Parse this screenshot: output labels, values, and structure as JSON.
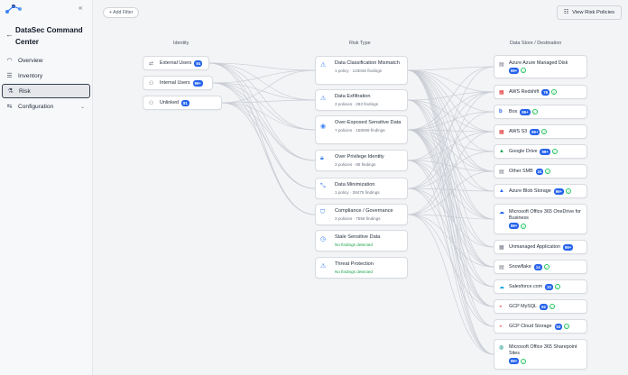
{
  "sidebar": {
    "app_title": "DataSec Command Center",
    "nav": [
      {
        "label": "Overview",
        "icon": "overview-icon"
      },
      {
        "label": "Inventory",
        "icon": "list-icon"
      },
      {
        "label": "Risk",
        "icon": "flask-icon",
        "active": true
      },
      {
        "label": "Configuration",
        "icon": "settings-icon"
      }
    ]
  },
  "toolbar": {
    "add_filter": "+ Add Filter",
    "view_risk_policies": "View Risk Policies"
  },
  "columns": {
    "identity": "Identity",
    "risk_type": "Risk Type",
    "data_store": "Data Store / Destination"
  },
  "identities": [
    {
      "label": "External Users",
      "count": "84"
    },
    {
      "label": "Internal Users",
      "count": "99+"
    },
    {
      "label": "Unlinked",
      "count": "81"
    }
  ],
  "risks": [
    {
      "title": "Data Classification Mismatch",
      "sub": "1 policy · 123046 findings"
    },
    {
      "title": "Data Exfiltration",
      "sub": "3 policies · 293 findings"
    },
    {
      "title": "Over-Exposed Sensitive Data",
      "sub": "7 policies · 158069 findings"
    },
    {
      "title": "Over Privilege Identity",
      "sub": "3 policies · 85 findings"
    },
    {
      "title": "Data Minimization",
      "sub": "1 policy · 38475 findings"
    },
    {
      "title": "Compliance / Governance",
      "sub": "3 policies · 7558 findings"
    },
    {
      "title": "Stale Sensitive Data",
      "sub": "No findings detected"
    },
    {
      "title": "Threat Protection",
      "sub": "No findings detected"
    }
  ],
  "stores": [
    {
      "label": "Azure Azure Managed Disk",
      "count": "99+"
    },
    {
      "label": "AWS Redshift",
      "count": "76"
    },
    {
      "label": "Box",
      "count": "99+"
    },
    {
      "label": "AWS S3",
      "count": "99+"
    },
    {
      "label": "Google Drive",
      "count": "99+"
    },
    {
      "label": "Other SMB",
      "count": "24"
    },
    {
      "label": "Azure Blob Storage",
      "count": "99+"
    },
    {
      "label": "Microsoft Office 365 OneDrive for Business",
      "count": "99+"
    },
    {
      "label": "Unmanaged Application",
      "count": "99+"
    },
    {
      "label": "Snowflake",
      "count": "14"
    },
    {
      "label": "Salesforce.com",
      "count": "33"
    },
    {
      "label": "GCP MySQL",
      "count": "62"
    },
    {
      "label": "GCP Cloud Storage",
      "count": "53"
    },
    {
      "label": "Microsoft Office 365 Sharepoint Sites",
      "count": "99+"
    }
  ],
  "colors": {
    "accent": "#2563eb",
    "ok": "#22c55e",
    "link": "#c5c9d1"
  }
}
